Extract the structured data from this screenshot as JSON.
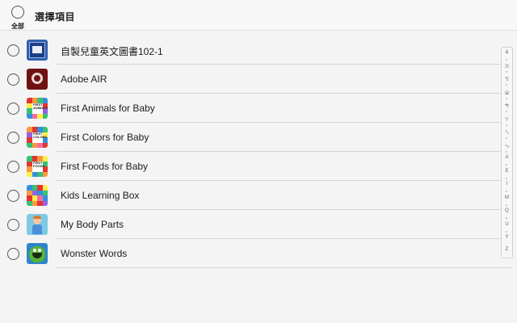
{
  "header": {
    "select_all_label": "全部",
    "title": "選擇項目"
  },
  "apps": [
    {
      "name": "自製兒童英文圖書102-1",
      "icon": "book-app-icon"
    },
    {
      "name": "Adobe AIR",
      "icon": "adobe-air-icon"
    },
    {
      "name": "First Animals for Baby",
      "icon": "first-animals-icon"
    },
    {
      "name": "First Colors for Baby",
      "icon": "first-colors-icon"
    },
    {
      "name": "First Foods for Baby",
      "icon": "first-foods-icon"
    },
    {
      "name": "Kids Learning Box",
      "icon": "kids-learning-box-icon"
    },
    {
      "name": "My Body Parts",
      "icon": "my-body-parts-icon"
    },
    {
      "name": "Wonster Words",
      "icon": "wonster-words-icon"
    }
  ],
  "icon_text": {
    "first_animals": "FIRST ANIMALS",
    "first_colors": "FIRST COLORS",
    "first_foods": "FIRST FOODS"
  },
  "index_bar": {
    "letters": [
      "&",
      "ㄉ",
      "ㄎ",
      "ㄓ",
      "ㄘ",
      "ㄚ",
      "ㄟ",
      "ㄣ",
      "A",
      "E",
      "I",
      "M",
      "Q",
      "U",
      "Y",
      "Z"
    ]
  },
  "colors": {
    "background": "#f4f4f4",
    "divider": "#d5d5d5",
    "text": "#1c1c1c"
  }
}
